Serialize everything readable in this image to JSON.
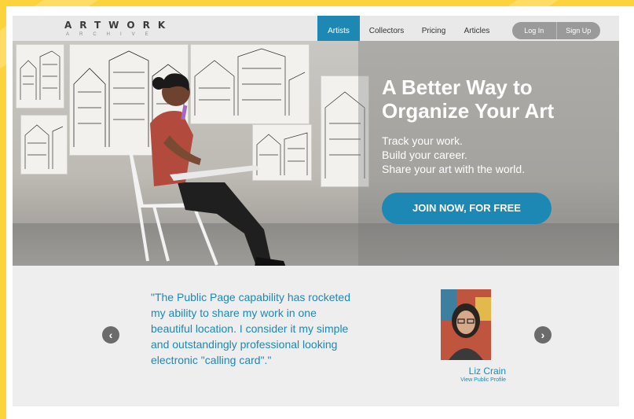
{
  "logo": {
    "main": "ARTWORK",
    "sub": "ARCHIVE"
  },
  "nav": {
    "items": [
      {
        "label": "Artists"
      },
      {
        "label": "Collectors"
      },
      {
        "label": "Pricing"
      },
      {
        "label": "Articles"
      }
    ],
    "login": "Log In",
    "signup": "Sign Up"
  },
  "hero": {
    "title_line1": "A Better Way to",
    "title_line2": "Organize Your Art",
    "lines": [
      "Track your work.",
      "Build your career.",
      "Share your art with the world."
    ],
    "cta_label": "JOIN NOW, FOR FREE"
  },
  "testimonial": {
    "quote_lines": [
      "\"The Public Page capability has rocketed",
      "my ability to share my work in one",
      "beautiful location. I consider it my simple",
      "and outstandingly professional looking",
      "electronic \"calling card\".\""
    ],
    "author": "Liz Crain",
    "profile_link": "View Public Profile"
  },
  "colors": {
    "accent": "#1e88b4",
    "page_background": "#fdd33c",
    "nav_background": "#e9e9e9",
    "testimonial_background": "#eeeeee",
    "arrow": "#6b6b6b"
  },
  "icons": {
    "prev": "chevron-left-icon",
    "next": "chevron-right-icon"
  }
}
